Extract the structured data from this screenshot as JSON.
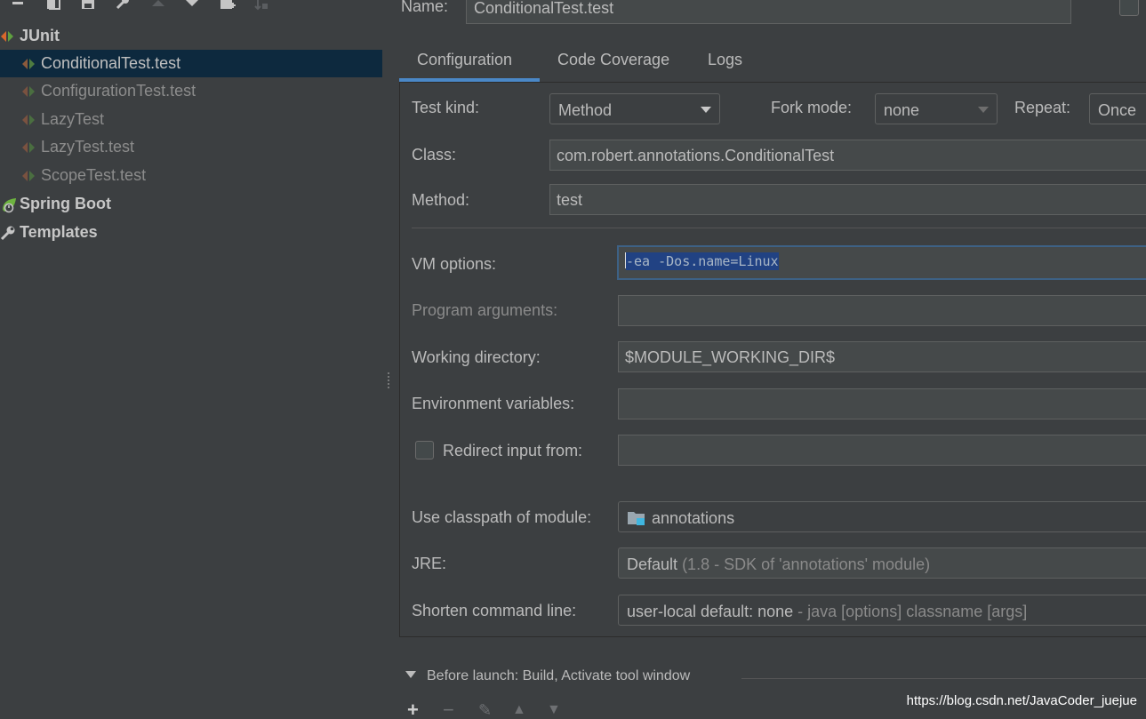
{
  "toolbar": {
    "icons": [
      "remove-icon",
      "copy-icon",
      "save-icon",
      "wrench-icon",
      "move-up-icon",
      "move-down-icon",
      "add-folder-icon",
      "sort-icon"
    ]
  },
  "tree": {
    "junit": {
      "label": "JUnit"
    },
    "items": [
      {
        "label": "ConditionalTest.test",
        "selected": true
      },
      {
        "label": "ConfigurationTest.test",
        "selected": false
      },
      {
        "label": "LazyTest",
        "selected": false
      },
      {
        "label": "LazyTest.test",
        "selected": false
      },
      {
        "label": "ScopeTest.test",
        "selected": false
      }
    ],
    "spring_boot": {
      "label": "Spring Boot"
    },
    "templates": {
      "label": "Templates"
    }
  },
  "header": {
    "name_label": "Name:",
    "name_value": "ConditionalTest.test"
  },
  "tabs": [
    {
      "label": "Configuration",
      "active": true
    },
    {
      "label": "Code Coverage",
      "active": false
    },
    {
      "label": "Logs",
      "active": false
    }
  ],
  "config": {
    "test_kind_label": "Test kind:",
    "test_kind_value": "Method",
    "fork_mode_label": "Fork mode:",
    "fork_mode_value": "none",
    "repeat_label": "Repeat:",
    "repeat_value": "Once",
    "class_label": "Class:",
    "class_value": "com.robert.annotations.ConditionalTest",
    "method_label": "Method:",
    "method_value": "test",
    "vm_options_label": "VM options:",
    "vm_options_value": "-ea -Dos.name=Linux",
    "program_args_label": "Program arguments:",
    "program_args_value": "",
    "working_dir_label": "Working directory:",
    "working_dir_value": "$MODULE_WORKING_DIR$",
    "env_vars_label": "Environment variables:",
    "env_vars_value": "",
    "redirect_label": "Redirect input from:",
    "redirect_value": "",
    "classpath_label": "Use classpath of module:",
    "classpath_value": "annotations",
    "jre_label": "JRE:",
    "jre_value": "Default",
    "jre_detail": "(1.8 - SDK of 'annotations' module)",
    "shorten_label": "Shorten command line:",
    "shorten_value": "user-local default: none",
    "shorten_detail": "- java [options] classname [args]"
  },
  "before_launch": {
    "label": "Before launch: Build, Activate tool window"
  },
  "watermark": "https://blog.csdn.net/JavaCoder_juejue",
  "colors": {
    "background": "#3c3f41",
    "selection": "#0d293e",
    "tab_accent": "#4a88c7",
    "text_selection": "#214283"
  }
}
